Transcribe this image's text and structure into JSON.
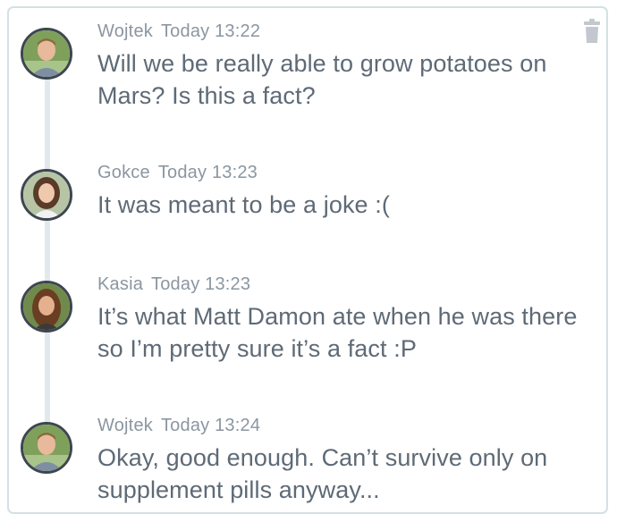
{
  "comments": [
    {
      "author": "Wojtek",
      "time": "Today 13:22",
      "text": "Will we be really able to grow potatoes on Mars? Is this a fact?",
      "avatar": "avatar-wojtek"
    },
    {
      "author": "Gokce",
      "time": "Today 13:23",
      "text": "It was meant to be a joke :(",
      "avatar": "avatar-gokce"
    },
    {
      "author": "Kasia",
      "time": "Today 13:23",
      "text": "It’s what Matt Damon ate when he was there so I’m pretty sure it’s a fact :P",
      "avatar": "avatar-kasia"
    },
    {
      "author": "Wojtek",
      "time": "Today 13:24",
      "text": "Okay, good enough. Can’t survive only on supplement pills anyway...",
      "avatar": "avatar-wojtek"
    }
  ],
  "icons": {
    "delete": "trash-icon"
  },
  "colors": {
    "border": "#d3e1e3",
    "avatar_ring": "#3d4650",
    "meta_text": "#8b96a1",
    "body_text": "#5e6a76",
    "timeline": "#e2e8ee",
    "trash": "#c2c8ce"
  }
}
